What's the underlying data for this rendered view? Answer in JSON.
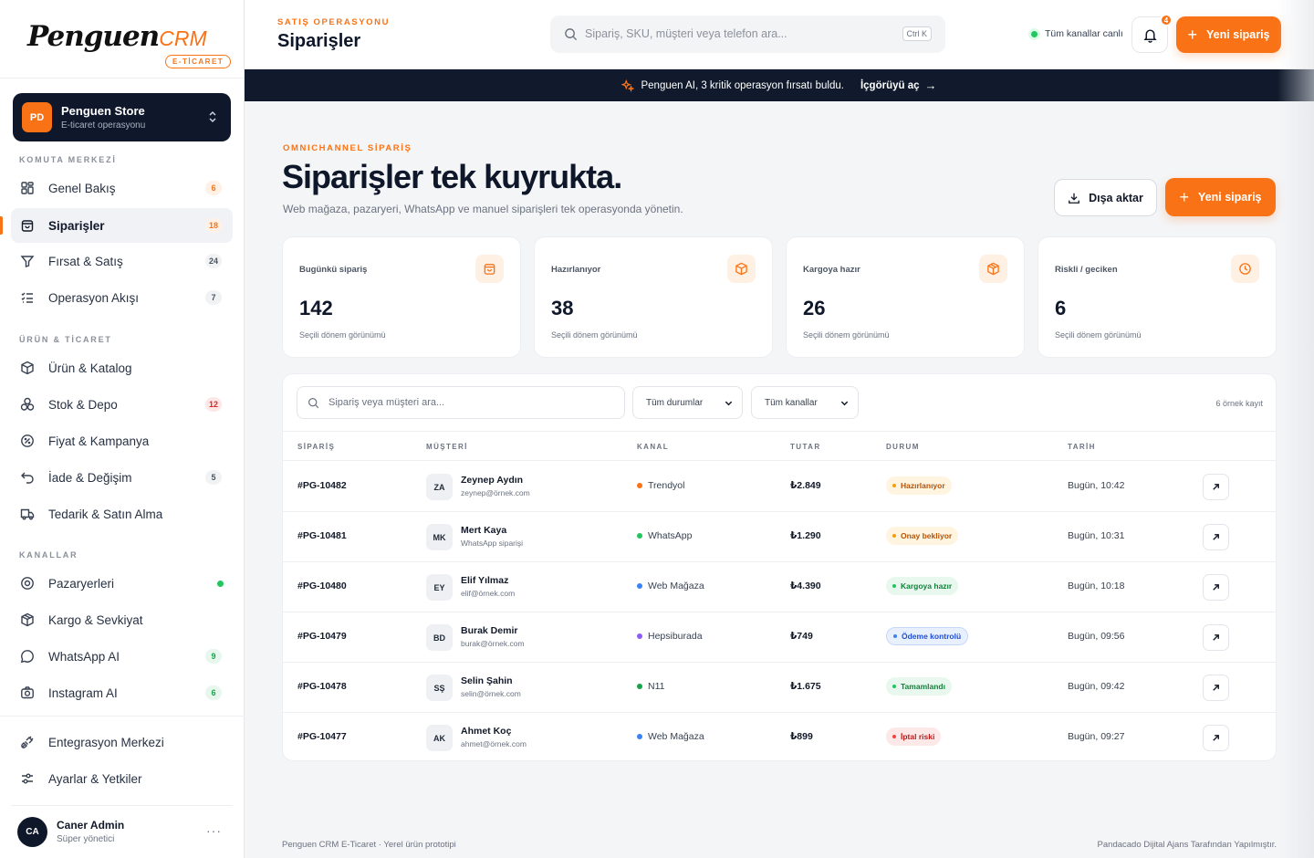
{
  "brand": {
    "wordmark": "Penguen",
    "crm": "CRM",
    "badge": "E-TİCARET"
  },
  "store": {
    "initials": "PD",
    "name": "Penguen Store",
    "subtitle": "E-ticaret operasyonu"
  },
  "sidebar": {
    "sections": [
      {
        "label": "KOMUTA MERKEZİ"
      },
      {
        "label": "ÜRÜN & TİCARET"
      },
      {
        "label": "KANALLAR"
      }
    ],
    "items": [
      {
        "label": "Genel Bakış",
        "count": "6",
        "icon": "grid-icon"
      },
      {
        "label": "Siparişler",
        "count": "18",
        "icon": "bag-icon"
      },
      {
        "label": "Fırsat & Satış",
        "count": "24",
        "icon": "funnel-icon"
      },
      {
        "label": "Operasyon Akışı",
        "count": "7",
        "icon": "list-check-icon"
      },
      {
        "label": "Ürün & Katalog",
        "count": "",
        "icon": "box-icon"
      },
      {
        "label": "Stok & Depo",
        "count": "12",
        "icon": "stack-boxes-icon"
      },
      {
        "label": "Fiyat & Kampanya",
        "count": "",
        "icon": "discount-icon"
      },
      {
        "label": "İade & Değişim",
        "count": "5",
        "icon": "return-icon"
      },
      {
        "label": "Tedarik & Satın Alma",
        "count": "",
        "icon": "truck-icon"
      },
      {
        "label": "Pazaryerleri",
        "count": "",
        "icon": "store-icon"
      },
      {
        "label": "Kargo & Sevkiyat",
        "count": "",
        "icon": "package-icon"
      },
      {
        "label": "WhatsApp AI",
        "count": "9",
        "icon": "chat-icon"
      },
      {
        "label": "Instagram AI",
        "count": "6",
        "icon": "camera-icon"
      },
      {
        "label": "Entegrasyon Merkezi",
        "count": "",
        "icon": "plug-icon"
      },
      {
        "label": "Ayarlar & Yetkiler",
        "count": "",
        "icon": "sliders-icon"
      }
    ]
  },
  "user": {
    "initials": "CA",
    "name": "Caner Admin",
    "role": "Süper yönetici",
    "more": "···"
  },
  "topbar": {
    "eyebrow": "SATIŞ OPERASYONU",
    "title": "Siparişler",
    "search_placeholder": "Sipariş, SKU, müşteri veya telefon ara...",
    "shortcut": "Ctrl K",
    "live_status": "Tüm kanallar canlı",
    "notification_count": "4",
    "new_order_label": "Yeni sipariş"
  },
  "banner": {
    "text": "Penguen AI, 3 kritik operasyon fırsatı buldu.",
    "link": "İçgörüyü aç",
    "arrow": "→"
  },
  "hero": {
    "eyebrow": "OMNICHANNEL SİPARİŞ",
    "title": "Siparişler tek kuyrukta.",
    "subtitle": "Web mağaza, pazaryeri, WhatsApp ve manuel siparişleri tek operasyonda yönetin.",
    "export_label": "Dışa aktar",
    "new_order_label": "Yeni sipariş"
  },
  "kpis": [
    {
      "label": "Bugünkü sipariş",
      "value": "142",
      "sub": "Seçili dönem görünümü",
      "icon": "bag-icon"
    },
    {
      "label": "Hazırlanıyor",
      "value": "38",
      "sub": "Seçili dönem görünümü",
      "icon": "box-icon"
    },
    {
      "label": "Kargoya hazır",
      "value": "26",
      "sub": "Seçili dönem görünümü",
      "icon": "package-icon"
    },
    {
      "label": "Riskli / geciken",
      "value": "6",
      "sub": "Seçili dönem görünümü",
      "icon": "clock-icon"
    }
  ],
  "table": {
    "search_placeholder": "Sipariş veya müşteri ara...",
    "status_filter": "Tüm durumlar",
    "channel_filter": "Tüm kanallar",
    "record_count": "6 örnek kayıt",
    "columns": [
      "SİPARİŞ",
      "MÜŞTERİ",
      "KANAL",
      "TUTAR",
      "DURUM",
      "TARİH"
    ],
    "rows": [
      {
        "id": "#PG-10482",
        "initials": "ZA",
        "name": "Zeynep Aydın",
        "contact": "zeynep@örnek.com",
        "channel": "Trendyol",
        "channel_color": "#f97316",
        "amount": "₺2.849",
        "status": "Hazırlanıyor",
        "status_tone": "orange",
        "date": "Bugün, 10:42"
      },
      {
        "id": "#PG-10481",
        "initials": "MK",
        "name": "Mert Kaya",
        "contact": "WhatsApp siparişi",
        "channel": "WhatsApp",
        "channel_color": "#22c55e",
        "amount": "₺1.290",
        "status": "Onay bekliyor",
        "status_tone": "orange",
        "date": "Bugün, 10:31"
      },
      {
        "id": "#PG-10480",
        "initials": "EY",
        "name": "Elif Yılmaz",
        "contact": "elif@örnek.com",
        "channel": "Web Mağaza",
        "channel_color": "#3b82f6",
        "amount": "₺4.390",
        "status": "Kargoya hazır",
        "status_tone": "green",
        "date": "Bugün, 10:18"
      },
      {
        "id": "#PG-10479",
        "initials": "BD",
        "name": "Burak Demir",
        "contact": "burak@örnek.com",
        "channel": "Hepsiburada",
        "channel_color": "#8b5cf6",
        "amount": "₺749",
        "status": "Ödeme kontrolü",
        "status_tone": "blue",
        "date": "Bugün, 09:56"
      },
      {
        "id": "#PG-10478",
        "initials": "SŞ",
        "name": "Selin Şahin",
        "contact": "selin@örnek.com",
        "channel": "N11",
        "channel_color": "#16a34a",
        "amount": "₺1.675",
        "status": "Tamamlandı",
        "status_tone": "green",
        "date": "Bugün, 09:42"
      },
      {
        "id": "#PG-10477",
        "initials": "AK",
        "name": "Ahmet Koç",
        "contact": "ahmet@örnek.com",
        "channel": "Web Mağaza",
        "channel_color": "#3b82f6",
        "amount": "₺899",
        "status": "İptal riski",
        "status_tone": "red",
        "date": "Bugün, 09:27"
      }
    ]
  },
  "footer": {
    "left": "Penguen CRM E-Ticaret · Yerel ürün prototipi",
    "right": "Pandacado Dijital Ajans Tarafından Yapılmıştır."
  },
  "colors": {
    "accent": "#f97316",
    "dark": "#0f172a",
    "banner": "#101a2c"
  }
}
